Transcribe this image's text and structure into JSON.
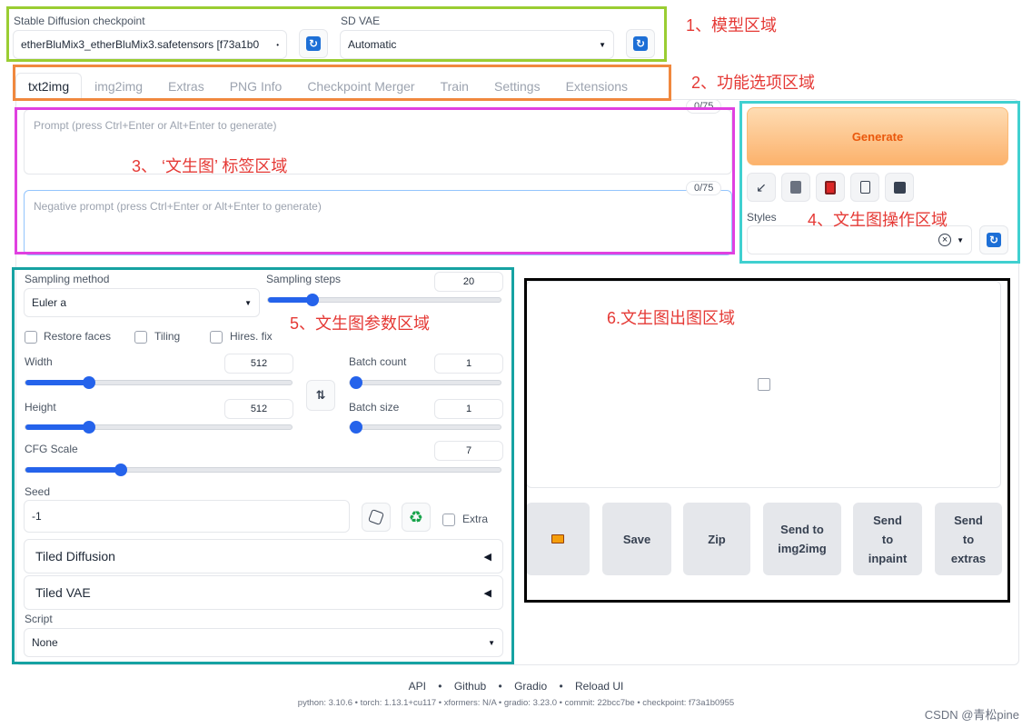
{
  "model": {
    "checkpoint_label": "Stable Diffusion checkpoint",
    "checkpoint_value": "etherBluMix3_etherBluMix3.safetensors [f73a1b0",
    "vae_label": "SD VAE",
    "vae_value": "Automatic"
  },
  "tabs": [
    "txt2img",
    "img2img",
    "Extras",
    "PNG Info",
    "Checkpoint Merger",
    "Train",
    "Settings",
    "Extensions"
  ],
  "prompt": {
    "placeholder": "Prompt (press Ctrl+Enter or Alt+Enter to generate)",
    "counter": "0/75",
    "negative_placeholder": "Negative prompt (press Ctrl+Enter or Alt+Enter to generate)",
    "negative_counter": "0/75"
  },
  "actions": {
    "generate_label": "Generate",
    "styles_label": "Styles",
    "styles_clear": "×",
    "tools": [
      "arrow-icon",
      "trash-icon",
      "card-icon",
      "clipboard-icon",
      "save-icon"
    ]
  },
  "params": {
    "sampling_method_label": "Sampling method",
    "sampling_method_value": "Euler a",
    "sampling_steps_label": "Sampling steps",
    "sampling_steps_value": "20",
    "sampling_steps_fraction": 0.19,
    "restore_faces": "Restore faces",
    "tiling": "Tiling",
    "hires_fix": "Hires. fix",
    "width_label": "Width",
    "width_value": "512",
    "width_fraction": 0.24,
    "height_label": "Height",
    "height_value": "512",
    "height_fraction": 0.24,
    "swap_icon": "⇅",
    "batch_count_label": "Batch count",
    "batch_count_value": "1",
    "batch_size_label": "Batch size",
    "batch_size_value": "1",
    "cfg_label": "CFG Scale",
    "cfg_value": "7",
    "cfg_fraction": 0.2,
    "seed_label": "Seed",
    "seed_value": "-1",
    "extra_label": "Extra",
    "tiled_diffusion": "Tiled Diffusion",
    "tiled_vae": "Tiled VAE",
    "accordion_arrow": "◀",
    "script_label": "Script",
    "script_value": "None"
  },
  "output": {
    "buttons": [
      "Save",
      "Zip",
      "Send to img2img",
      "Send to inpaint",
      "Send to extras"
    ]
  },
  "annotations": {
    "a1": "1、模型区域",
    "a2": "2、功能选项区域",
    "a3": "3、 ‘文生图’ 标签区域",
    "a4": "4、文生图操作区域",
    "a5": "5、文生图参数区域",
    "a6": "6.文生图出图区域"
  },
  "footer": {
    "links": [
      "API",
      "Github",
      "Gradio",
      "Reload UI"
    ],
    "meta": "python: 3.10.6  •  torch: 1.13.1+cu117  •  xformers: N/A  •  gradio: 3.23.0  •  commit: 22bcc7be  •  checkpoint: f73a1b0955",
    "watermark": "CSDN @青松pine"
  },
  "colors": {
    "box1": "#9acd32",
    "box2": "#f0883e",
    "box3": "#e040e0",
    "box4": "#40d0d0",
    "box5": "#16a2a2",
    "box6": "#000000",
    "annotation": "#e53935",
    "accent": "#2563eb",
    "generate": "#fcb26c"
  }
}
